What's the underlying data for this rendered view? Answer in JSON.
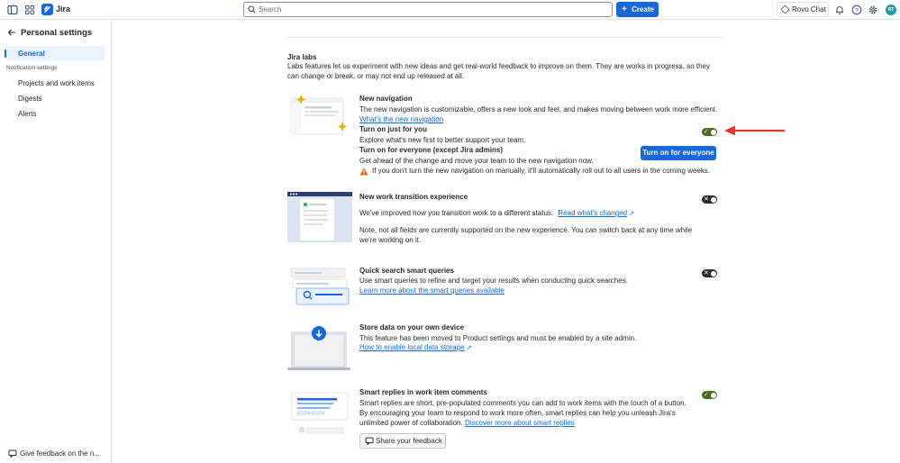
{
  "topbar": {
    "app_name": "Jira",
    "search_placeholder": "Search",
    "create_label": "Create",
    "rovo_label": "Rovo Chat",
    "avatar_initials": "RT"
  },
  "sidebar": {
    "title": "Personal settings",
    "general": "General",
    "section_label": "Notification settings",
    "items": [
      "Projects and work items",
      "Digests",
      "Alerts"
    ],
    "feedback": "Give feedback on the n..."
  },
  "labs": {
    "title": "Jira labs",
    "description": "Labs features let us experiment with new ideas and get real-world feedback to improve on them. They are works in progress, so they can change or break, or may not end up released at all."
  },
  "features": {
    "nav": {
      "title": "New navigation",
      "desc": "The new navigation is customizable, offers a new look and feel, and makes moving between work more efficient.",
      "link": "What's the new navigation",
      "just_you_title": "Turn on just for you",
      "just_you_desc": "Explore what's new first to better support your team.",
      "everyone_title": "Turn on for everyone (except Jira admins)",
      "everyone_desc": "Get ahead of the change and move your team to the new navigation now.",
      "button": "Turn on for everyone",
      "warning": "If you don't turn the new navigation on manually, it'll automatically roll out to all users in the coming weeks.",
      "toggle": "on"
    },
    "transition": {
      "title": "New work transition experience",
      "desc": "We've improved how you transition work to a different status.",
      "link": "Read what's changed",
      "note": "Note, not all fields are currently supported on the new experience. You can switch back at any time while we're working on it.",
      "toggle": "off"
    },
    "search": {
      "title": "Quick search smart queries",
      "desc": "Use smart queries to refine and target your results when conducting quick searches.",
      "link": "Learn more about the smart queries available",
      "toggle": "off"
    },
    "storage": {
      "title": "Store data on your own device",
      "desc": "This feature has been moved to Product settings and must be enabled by a site admin.",
      "link": "How to enable local data storage"
    },
    "replies": {
      "title": "Smart replies in work item comments",
      "desc": "Smart replies are short, pre-populated comments you can add to work items with the touch of a button. By encouraging your team to respond to work more often, smart replies can help you unleash Jira's unlimited power of collaboration.",
      "link": "Discover more about smart replies",
      "button": "Share your feedback",
      "toggle": "on"
    }
  },
  "colors": {
    "primary": "#1868db",
    "toggle_on": "#4c6b1f",
    "toggle_off": "#292a2e",
    "annotation_arrow": "#e5382a"
  }
}
